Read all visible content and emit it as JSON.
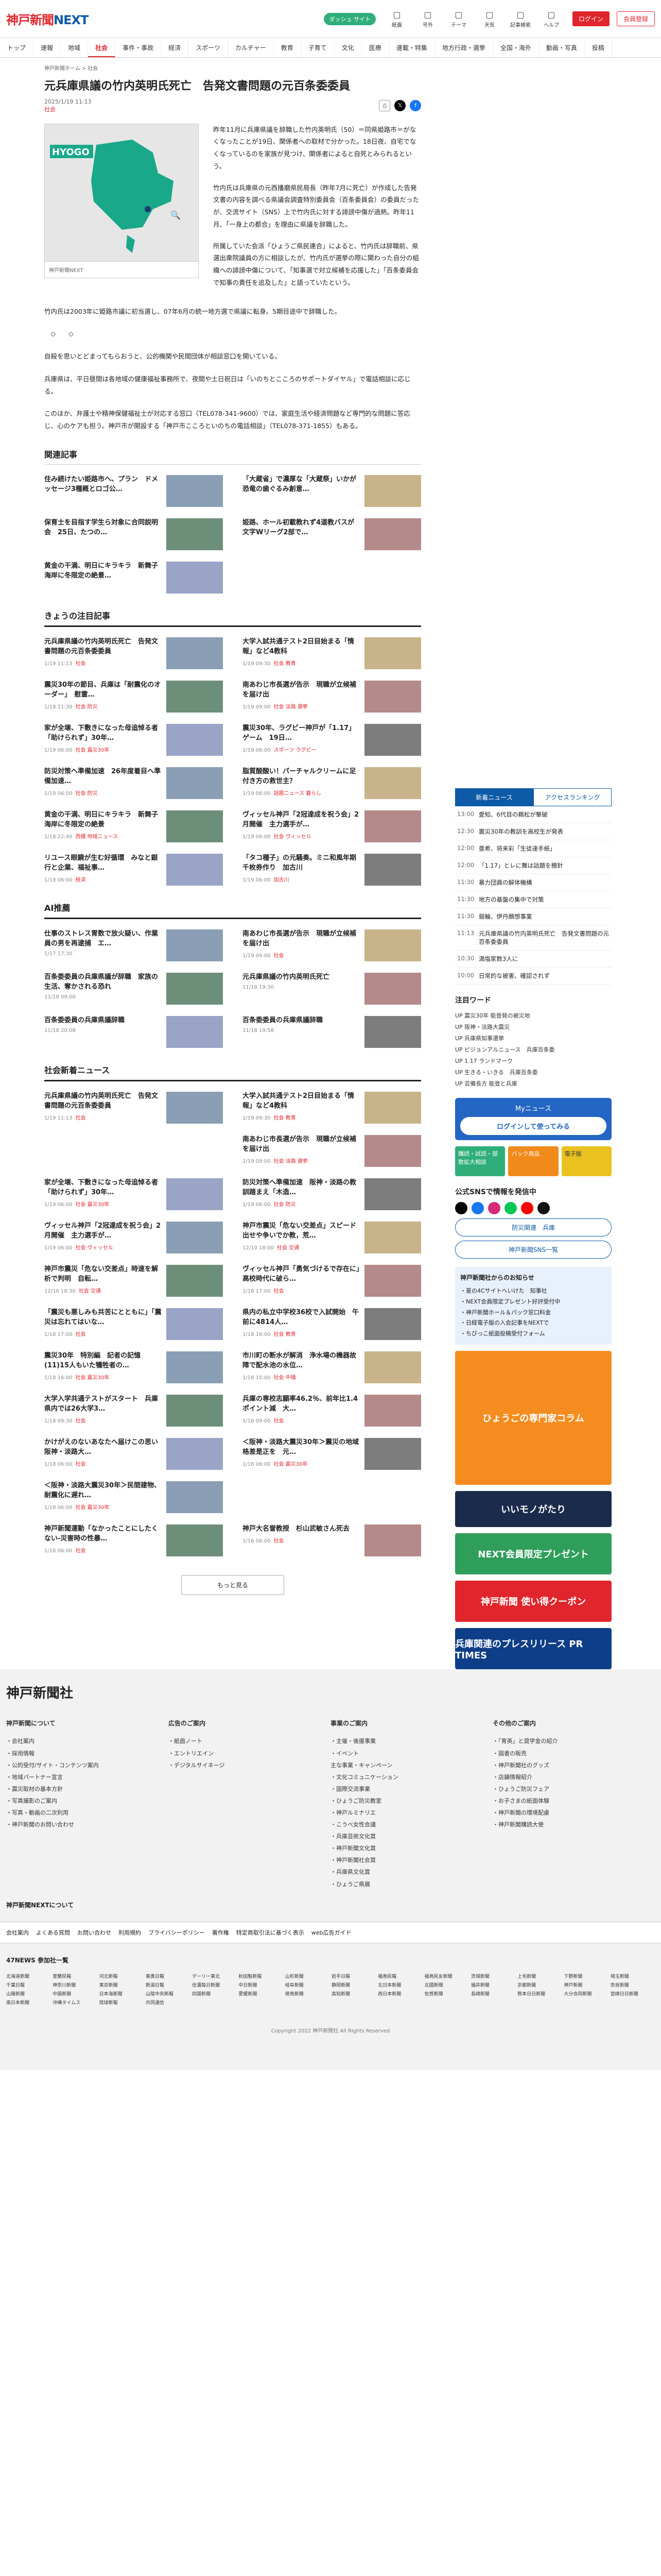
{
  "header": {
    "logo_a": "神戸新聞",
    "logo_b": "NEXT",
    "pill": "ダッシュ サイト",
    "icons": [
      {
        "name": "紙面",
        "icon": "newspaper-icon"
      },
      {
        "name": "号外",
        "icon": "extra-icon"
      },
      {
        "name": "テーマ",
        "icon": "theme-icon"
      },
      {
        "name": "天気",
        "icon": "weather-icon"
      },
      {
        "name": "記事検索",
        "icon": "search-icon"
      },
      {
        "name": "ヘルプ",
        "icon": "help-icon"
      }
    ],
    "login": "ログイン",
    "register": "会員登録"
  },
  "nav": [
    "トップ",
    "速報",
    "地域",
    "社会",
    "事件・事故",
    "経済",
    "スポーツ",
    "カルチャー",
    "教育",
    "子育て",
    "文化",
    "医療",
    "連載・特集",
    "地方行政・選挙",
    "全国・海外",
    "動画・写真",
    "投稿"
  ],
  "breadcrumb": "神戸新聞ホーム > 社会",
  "article": {
    "title": "元兵庫県議の竹内英明氏死亡　告発文書問題の元百条委委員",
    "date": "2025/1/19 11:13",
    "tag": "社会",
    "caption": "神戸新聞NEXT",
    "p1": "昨年11月に兵庫県議を辞職した竹内英明氏（50）＝同県姫路市＝がなくなったことが19日、関係者への取材で分かった。18日夜、自宅でなくなっているのを家族が見つけ、関係者によると自死とみられるという。",
    "p2": "竹内氏は兵庫県の元西播磨県民局長（昨年7月に死亡）が作成した告発文書の内容を調べる県議会調査特別委員会（百条委員会）の委員だったが、交流サイト（SNS）上で竹内氏に対する誹謗中傷が過熱。昨年11月、「一身上の都合」を理由に県議を辞職した。",
    "p3": "所属していた会派「ひょうご県民連合」によると、竹内氏は辞職前、県選出衆院議員の方に相談したが、竹内氏が選挙の際に関わった自分の組織への誹謗中傷について、「知事選で対立候補を応援した」「百条委員会で知事の責任を追及した」と語っていたという。",
    "p4": "竹内氏は2003年に姫路市議に初当選し、07年6月の統一地方選で県議に転身。5期目途中で辞職した。",
    "p5": "　◇　　◇",
    "p6": "自殺を思いとどまってもらおうと、公的機関や民間団体が相談窓口を開いている。",
    "p7": "兵庫県は、平日昼間は各地域の健康福祉事務所で、夜間や土日祝日は「いのちとこころのサポートダイヤル」で電話相談に応じる。",
    "p8": "このほか、弁護士や精神保健福祉士が対応する窓口（TEL078-341-9600）では、家庭生活や経済問題など専門的な問題に答応じ、心のケアも担う。神戸市が開設する「神戸市こころといのちの電話相談」（TEL078-371-1855）もある。"
  },
  "map_label": "HYOGO",
  "sections": {
    "related": "関連記事",
    "attention": "きょうの注目記事",
    "ai": "AI推薦",
    "society": "社会新着ニュース",
    "more": "もっと見る"
  },
  "related": [
    {
      "t": "住み続けたい姫路市へ、プラン　ドメッセージ3種概とロゴ公…",
      "d": "",
      "c": ""
    },
    {
      "t": "「大蔵省」で濃厚な「大蔵祭」いかが　恐竜の歯ぐるみ創意…",
      "d": "",
      "c": ""
    },
    {
      "t": "保育士を目指す学生ら対象に合同説明会　25日、たつの…",
      "d": "",
      "c": ""
    },
    {
      "t": "姫路、ホール初載教れず4道教バスが文字Wリーグ2部で…",
      "d": "",
      "c": ""
    },
    {
      "t": "黄金の干満、明日にキラキラ　新舞子海岸に冬限定の絶景…",
      "d": "",
      "c": ""
    }
  ],
  "attention": [
    {
      "t": "元兵庫県議の竹内英明氏死亡　告発文書問題の元百条委委員",
      "d": "1/19 11:13",
      "c": "社会"
    },
    {
      "t": "大学入試共通テスト2日目始まる「情報」など4教科",
      "d": "1/19 09:30",
      "c": "社会 教育"
    },
    {
      "t": "震災30年の節目、兵庫は「耐震化のオーダー」　慰霊…",
      "d": "1/18 21:30",
      "c": "社会 防災"
    },
    {
      "t": "南あわじ市長選が告示　現職が立候補を届け出",
      "d": "1/19 09:00",
      "c": "社会 淡路 選挙"
    },
    {
      "t": "家が全壊、下敷きになった母追悼る者「助けられず」30年…",
      "d": "1/19 06:00",
      "c": "社会 震災30年"
    },
    {
      "t": "震災30年、ラグビー神戸が「1.17」ゲーム　19日…",
      "d": "1/19 06:00",
      "c": "スポーツ ラグビー"
    },
    {
      "t": "防災対策へ準備加速　26年度着目へ準備加速…",
      "d": "1/19 06:00",
      "c": "社会 防災"
    },
    {
      "t": "脂質酸酸い！パーチャルクリームに足付き方の救世主？",
      "d": "1/19 06:00",
      "c": "話題ニュース 暮らし"
    },
    {
      "t": "黄金の干満、明日にキラキラ　新舞子海岸に冬限定の絶景",
      "d": "1/18 22:40",
      "c": "西播 地域ニュース"
    },
    {
      "t": "ヴィッセル神戸「2冠達成を祝う会」2月開催　主力選手が…",
      "d": "1/19 06:00",
      "c": "社会 ヴィッセル"
    },
    {
      "t": "リユース眼鏡が生む好循環　みなと銀行と企業、福祉事…",
      "d": "1/19 06:00",
      "c": "経済"
    },
    {
      "t": "「タコ種子」の元騒奏。ミニ和風年期千枚券作り　加古川",
      "d": "1/19 06:00",
      "c": "加古川"
    }
  ],
  "ai": [
    {
      "t": "仕事のストレス胃数で放火疑い、作業員の男を再逮捕　エ…",
      "d": "1/17 17:30",
      "c": ""
    },
    {
      "t": "南あわじ市長選が告示　現職が立候補を届け出",
      "d": "1/19 09:00",
      "c": "社会"
    },
    {
      "t": "百条委委員の兵庫県議が辞職　家族の生活、奪かされる恐れ",
      "d": "11/18 09:00",
      "c": ""
    },
    {
      "t": "元兵庫県議の竹内英明氏死亡",
      "d": "11/18 19:30",
      "c": ""
    },
    {
      "t": "百条委委員の兵庫県議辞職",
      "d": "11/18 20:08",
      "c": ""
    },
    {
      "t": "百条委委員の兵庫県議辞職",
      "d": "11/18 19:58",
      "c": ""
    }
  ],
  "society": [
    {
      "t": "元兵庫県議の竹内英明氏死亡　告発文書問題の元百条委委員",
      "d": "1/19 11:13",
      "c": "社会"
    },
    {
      "t": "大学入試共通テスト2日目始まる「情報」など4教科",
      "d": "1/19 09:30",
      "c": "社会 教育"
    },
    {
      "t": "",
      "d": "",
      "c": ""
    },
    {
      "t": "南あわじ市長選が告示　現職が立候補を届け出",
      "d": "1/19 09:00",
      "c": "社会 淡路 選挙"
    },
    {
      "t": "家が全壊、下敷きになった母追悼る者「助けられず」30年…",
      "d": "1/19 06:00",
      "c": "社会 震災30年"
    },
    {
      "t": "防災対策へ準備加速　阪神・淡路の教訓踏まえ「木造…",
      "d": "1/19 06:00",
      "c": "社会 防災"
    },
    {
      "t": "ヴィッセル神戸「2冠達成を祝う会」2月開催　主力選手が…",
      "d": "1/19 06:00",
      "c": "社会 ヴィッセル"
    },
    {
      "t": "神戸市震災「危ない交差点」スピード出せや争いでか教，荒…",
      "d": "12/10 18:00",
      "c": "社会 交通"
    },
    {
      "t": "神戸市震災「危ない交差点」時速を解析で判明　自転…",
      "d": "12/16 18:30",
      "c": "社会 交通"
    },
    {
      "t": "ヴィッセル神戸「勇気づけるで存在に」　高校時代に破ら…",
      "d": "1/18 17:00",
      "c": "社会"
    },
    {
      "t": "「震災も悪しみも共苦にとともに」「震災は忘れてはいな…",
      "d": "1/18 17:00",
      "c": "社会"
    },
    {
      "t": "県内の私立中学校36校で入試開始　午前に4814人…",
      "d": "1/18 16:00",
      "c": "社会 教育"
    },
    {
      "t": "震災30年　特別編　記者の記憶(11)15人もいた犠牲者の…",
      "d": "1/18 16:00",
      "c": "社会 震災30年"
    },
    {
      "t": "市川町の断水が解消　浄水場の機器故障で配水池の水位…",
      "d": "1/18 15:00",
      "c": "社会 中播"
    },
    {
      "t": "大学入学共通テストがスタート　兵庫県内では26大学3…",
      "d": "1/18 09:30",
      "c": "社会"
    },
    {
      "t": "兵庫の専校志願率46.2％、前年比1.4ポイント減　大…",
      "d": "1/18 09:00",
      "c": "社会"
    },
    {
      "t": "かけがえのないあなたへ届けこの思い　阪神・淡路大…",
      "d": "1/18 06:00",
      "c": "社会"
    },
    {
      "t": "＜阪神・淡路大震災30年＞震災の地域格差是正を　元…",
      "d": "1/18 06:00",
      "c": "社会 震災30年"
    },
    {
      "t": "＜阪神・淡路大震災30年＞民間建物、耐震化に遅れ…",
      "d": "1/18 06:00",
      "c": "社会 震災30年"
    },
    {
      "t": "",
      "d": "",
      "c": ""
    },
    {
      "t": "神戸新聞運動「なかったことにしたくない-災害時の性暴…",
      "d": "1/18 06:00",
      "c": "社会"
    },
    {
      "t": "神戸大名誉教授　杉山武敏さん死去",
      "d": "1/18 06:00",
      "c": "社会"
    }
  ],
  "side": {
    "tab1": "新着ニュース",
    "tab2": "アクセスランキング",
    "ranking": [
      {
        "time": "13:00",
        "t": "愛知、6代目の鵜松が撃破"
      },
      {
        "time": "12:30",
        "t": "震災30年の教訓を高校生が発表"
      },
      {
        "time": "12:00",
        "t": "亜希、将来彩「生徒達手紙」"
      },
      {
        "time": "12:00",
        "t": "「1.17」とレに舞は話題を棚針"
      },
      {
        "time": "11:30",
        "t": "暴力団員の解体機構"
      },
      {
        "time": "11:30",
        "t": "地方の基盤の集中で対策"
      },
      {
        "time": "11:30",
        "t": "競輪、伊丹願想事業"
      },
      {
        "time": "11:13",
        "t": "元兵庫県議の竹内英明氏死亡　告発文書問題の元百条委委員"
      },
      {
        "time": "10:30",
        "t": "満塩家数3人に"
      },
      {
        "time": "10:00",
        "t": "日常的な被害、確認されず"
      }
    ],
    "kw_title": "注目ワード",
    "keywords": [
      "UP 震災30年 能登発の被災地",
      "UP 阪神・淡路大震災",
      "UP 兵庫県知事選挙",
      "UP ビジョンアルニュース　兵庫百条委",
      "UP 1.17 ランドマーク",
      "UP 生きる・いきる　兵庫百条委",
      "UP 芸備長方 能登と兵庫"
    ],
    "mynews": "Myニュース",
    "mynews_btn": "ログインして使ってみる",
    "boxes": [
      "購読・試読・部数拡大相談",
      "パック商品",
      "電子版"
    ],
    "sns_title": "公式SNSで情報を発信中",
    "line": "防災関連　兵庫",
    "app": "神戸新聞SNS一覧",
    "notice_title": "神戸新聞社からのお知らせ",
    "notices": [
      "・夏の4Cサイトへいけた　知事社",
      "・NEXT会員限定プレゼント好評受付中",
      "・神戸新聞ホール＆パック窓口料金",
      "・日経電子版の入会記事をNEXTで",
      "・ちびっこ紙面投稿受付フォーム"
    ],
    "ad_column": "ひょうごの専門家コラム",
    "ads": [
      "いいモノがたり",
      "NEXT会員限定プレゼント",
      "神戸新聞 使い得クーポン",
      "兵庫関連のプレスリリース PR TIMES"
    ]
  },
  "footer": {
    "logo": "神戸新聞社",
    "cols": [
      {
        "h": "神戸新聞について",
        "items": [
          "・会社案内",
          "・採用情報",
          "・公的受付/サイト・コンテンツ案内",
          "・地域パートナー宣言",
          "・震災取材の基本方針",
          "・写真撮影のご案内",
          "・写真・動画の二次利用",
          "・神戸新聞のお問い合わせ"
        ]
      },
      {
        "h": "広告のご案内",
        "items": [
          "・紙面ノート",
          "・エントリエイン",
          "・デジタルサイネージ"
        ]
      },
      {
        "h": "事業のご案内",
        "items": [
          "・主催・後援事業",
          "・イベント",
          "主な事業・キャンペーン",
          "・文化コミュニケーション",
          "・国際交流事業",
          "・ひょうご防災教室",
          "・神戸ルミナリエ",
          "・こうべ女性会議",
          "・兵庫芸術文化賞",
          "・神戸新聞文化賞",
          "・神戸新聞社会賞",
          "・兵庫県文化賞",
          "・ひょうご県展"
        ]
      },
      {
        "h": "その他のご案内",
        "items": [
          "・「育英」と奨学金の紹介",
          "・図書の販売",
          "・神戸新聞社のグッズ",
          "・店舗情報紹介",
          "・ひょうご防災フェア",
          "・お子さまの紙面体験",
          "・神戸新聞の環境配慮",
          "・神戸新聞購読大使"
        ]
      }
    ],
    "next_title": "神戸新聞NEXTについて",
    "nav": [
      "会社案内",
      "よくある質問",
      "お問い合わせ",
      "利用規約",
      "プライバシーポリシー",
      "著作権",
      "特定商取引法に基づく表示",
      "web広告ガイド"
    ],
    "regions_title": "47NEWS 参加社一覧",
    "regions": [
      "北海道新聞",
      "室蘭民報",
      "河北新報",
      "東奥日報",
      "デーリー東北",
      "秋田魁新報",
      "山形新聞",
      "岩手日報",
      "福島民報",
      "福島民友新聞",
      "茨城新聞",
      "上毛新聞",
      "下野新聞",
      "埼玉新聞",
      "千葉日報",
      "神奈川新聞",
      "東京新聞",
      "新潟日報",
      "信濃毎日新聞",
      "中日新聞",
      "岐阜新聞",
      "静岡新聞",
      "北日本新聞",
      "北國新聞",
      "福井新聞",
      "京都新聞",
      "神戸新聞",
      "奈良新聞",
      "山陽新聞",
      "中国新聞",
      "日本海新聞",
      "山陰中央新報",
      "四国新聞",
      "愛媛新聞",
      "徳島新聞",
      "高知新聞",
      "西日本新聞",
      "佐賀新聞",
      "長崎新聞",
      "熊本日日新聞",
      "大分合同新聞",
      "宮崎日日新聞",
      "南日本新聞",
      "沖縄タイムス",
      "琉球新報",
      "共同通信"
    ],
    "copy": "Copyright 2022 神戸新聞社 All Rights Reserved"
  },
  "colors": {
    "brand_red": "#e0262c",
    "brand_blue": "#0d5aa7",
    "map_green": "#19a88a"
  }
}
